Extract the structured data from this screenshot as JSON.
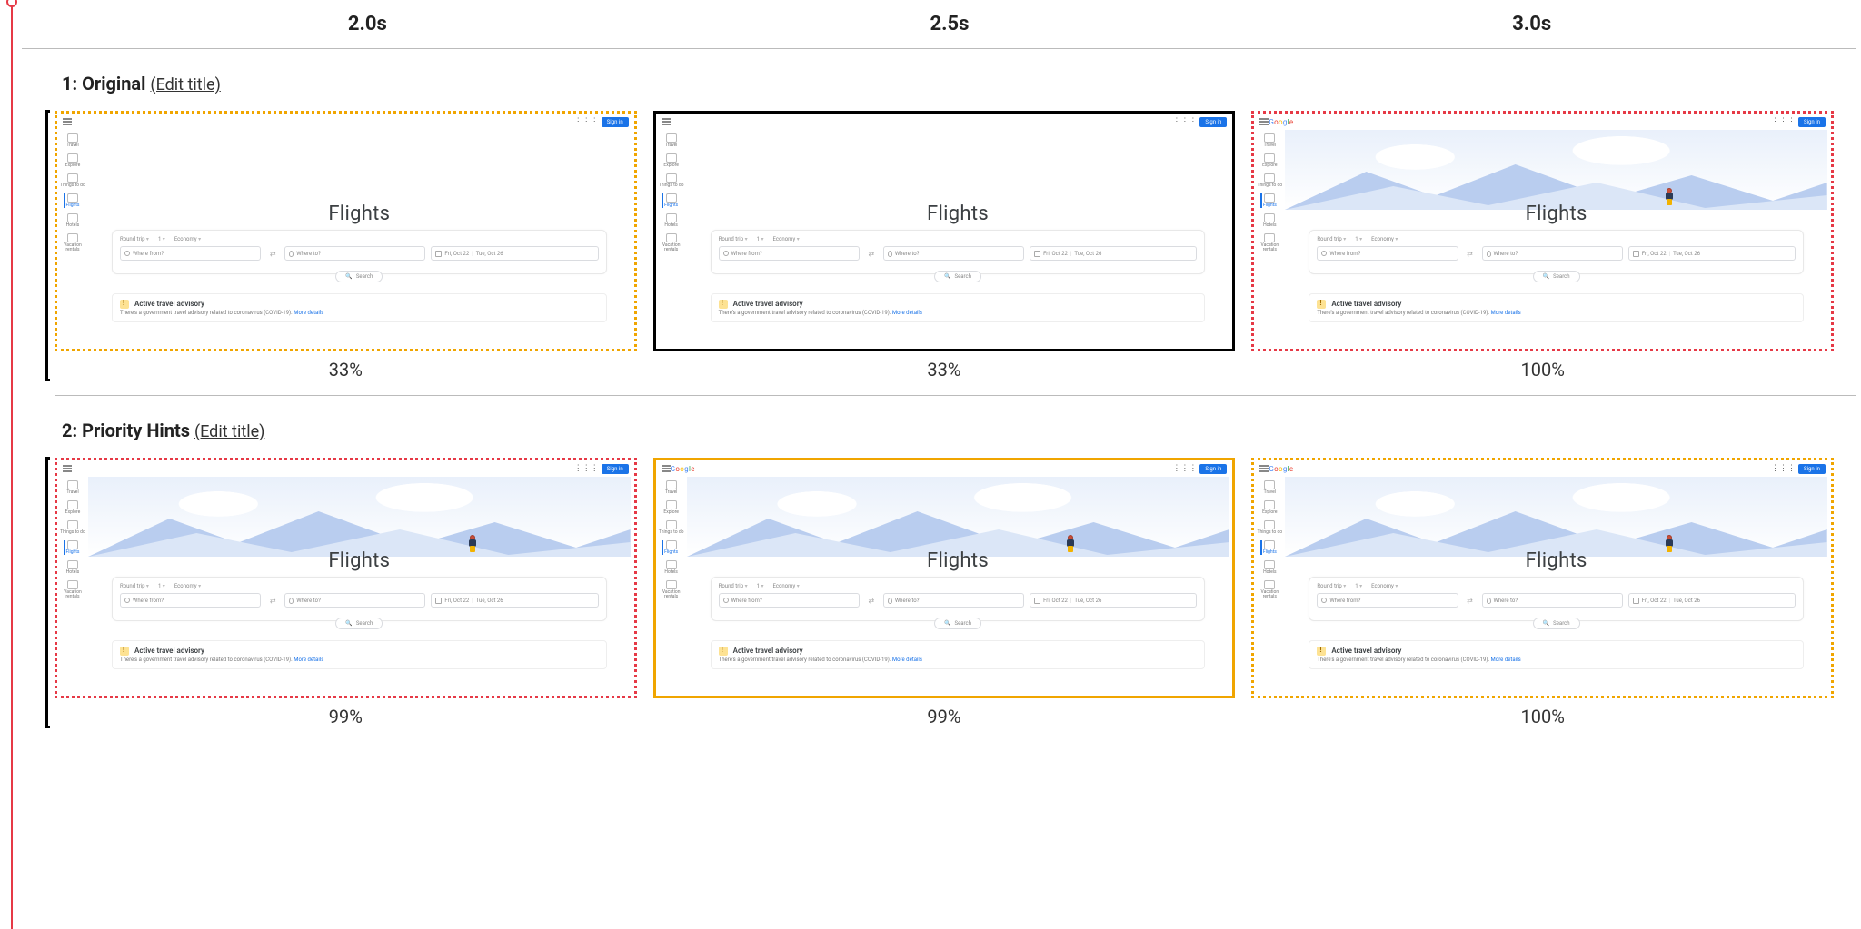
{
  "timeline": {
    "times": [
      "2.0s",
      "2.5s",
      "3.0s"
    ]
  },
  "rows": [
    {
      "label_prefix": "1:",
      "label": "Original",
      "edit": "(Edit title)",
      "frames": [
        {
          "progress": "33%",
          "border": "border-dotted-orange",
          "hero": "blank",
          "show_logo": false,
          "marked": true
        },
        {
          "progress": "33%",
          "border": "border-solid-black",
          "hero": "blank",
          "show_logo": false,
          "marked": false
        },
        {
          "progress": "100%",
          "border": "border-dotted-red",
          "hero": "illus",
          "show_logo": true,
          "marked": false
        }
      ]
    },
    {
      "label_prefix": "2:",
      "label": "Priority Hints",
      "edit": "(Edit title)",
      "frames": [
        {
          "progress": "99%",
          "border": "border-dotted-red",
          "hero": "illus",
          "show_logo": false,
          "marked": true
        },
        {
          "progress": "99%",
          "border": "border-solid-orange",
          "hero": "illus",
          "show_logo": true,
          "marked": false
        },
        {
          "progress": "100%",
          "border": "border-dotted-orange",
          "hero": "illus",
          "show_logo": true,
          "marked": false
        }
      ]
    }
  ],
  "mini": {
    "signin": "Sign in",
    "logo": "Google",
    "side_items": [
      "Travel",
      "Explore",
      "Things to do",
      "Flights",
      "Hotels",
      "Vacation rentals"
    ],
    "selected_side": "Flights",
    "title": "Flights",
    "chips": {
      "trip": "Round trip",
      "pax": "1",
      "cabin": "Economy"
    },
    "inputs": {
      "from_placeholder": "Where from?",
      "to_placeholder": "Where to?",
      "date1": "Fri, Oct 22",
      "date2": "Tue, Oct 26"
    },
    "search": "Search",
    "advisory": {
      "title": "Active travel advisory",
      "body": "There's a government travel advisory related to coronavirus (COVID-19).",
      "link": "More details"
    }
  }
}
